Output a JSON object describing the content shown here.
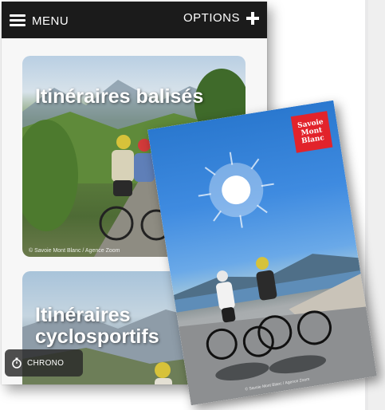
{
  "topbar": {
    "menu_label": "MENU",
    "options_label": "OPTIONS",
    "background": "#1b1b1b"
  },
  "cards": [
    {
      "title_line1": "Itinéraires balisés",
      "title_line2": "",
      "credit": "© Savoie Mont Blanc / Agence Zoom"
    },
    {
      "title_line1": "Itinéraires",
      "title_line2": "cyclosportifs"
    }
  ],
  "chrono": {
    "label": "CHRONO"
  },
  "brochure": {
    "brand_line1": "Savoie",
    "brand_line2": "Mont",
    "brand_line3": "Blanc",
    "brand_color": "#e2232b",
    "credit": "© Savoie Mont Blanc / Agence Zoom"
  },
  "icons": {
    "menu": "hamburger-icon",
    "options": "plus-icon",
    "chrono": "stopwatch-icon"
  }
}
